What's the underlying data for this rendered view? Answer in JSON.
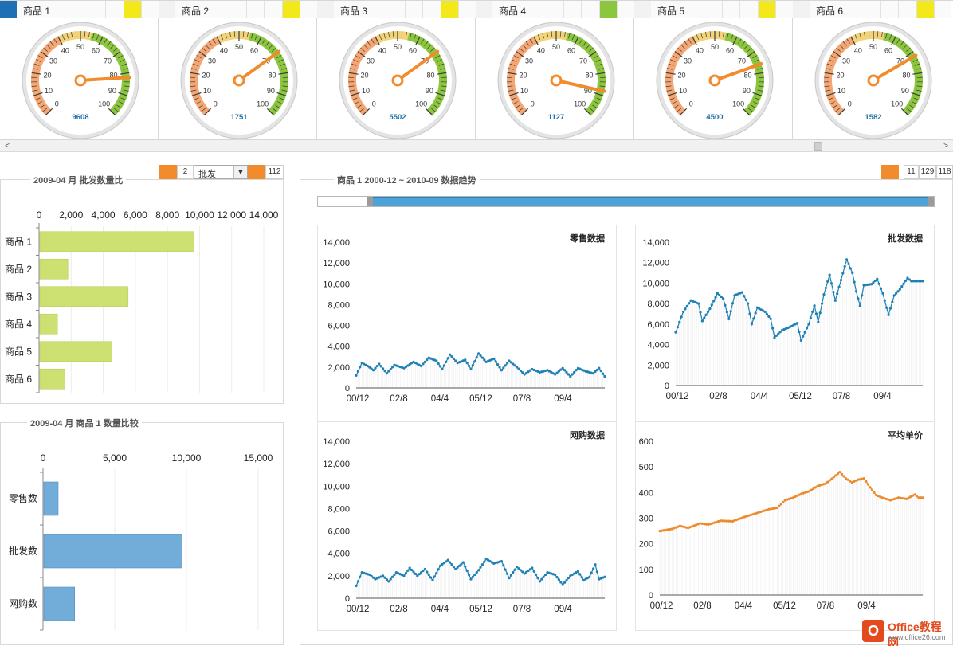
{
  "colors": {
    "accent_orange": "#f28b2b",
    "selected_blue": "#1f6fb5",
    "flag_yellow": "#f3e81a",
    "flag_green": "#8cc63f",
    "bar_lime": "#cde172",
    "bar_blue": "#72acd8",
    "line_blue": "#1f80b4",
    "line_orange": "#ee8a2c"
  },
  "gauges": [
    {
      "name": "商品 1",
      "value": 9608,
      "needle": 82,
      "flag": "yellow",
      "selected": true
    },
    {
      "name": "商品 2",
      "value": 1751,
      "needle": 70,
      "flag": "yellow",
      "selected": false
    },
    {
      "name": "商品 3",
      "value": 5502,
      "needle": 70,
      "flag": "yellow",
      "selected": false
    },
    {
      "name": "商品 4",
      "value": 1127,
      "needle": 88,
      "flag": "green",
      "selected": false
    },
    {
      "name": "商品 5",
      "value": 4500,
      "needle": 76,
      "flag": "yellow",
      "selected": false
    },
    {
      "name": "商品 6",
      "value": 1582,
      "needle": 72,
      "flag": "yellow",
      "selected": false
    }
  ],
  "gauge_ticks": [
    "0",
    "10",
    "20",
    "30",
    "40",
    "50",
    "60",
    "70",
    "80",
    "90",
    "100"
  ],
  "scroll": {
    "left_arrow": "<",
    "right_arrow": ">"
  },
  "wholesale_panel": {
    "title": "2009-04 月 批发数量比",
    "counter": "2",
    "dropdown_value": "批发",
    "dropdown_arrow": "▼",
    "right_value": "112"
  },
  "compare_panel": {
    "title": "2009-04 月  商品 1 数量比较"
  },
  "trend_panel": {
    "title": "商品 1   2000-12 ~ 2010-09  数据趋势",
    "boxes": [
      "11",
      "129",
      "118"
    ]
  },
  "chart_data": [
    {
      "id": "wholesale_ratio",
      "type": "bar",
      "orientation": "horizontal",
      "title": "2009-04 月 批发数量比",
      "categories": [
        "商品 1",
        "商品 2",
        "商品 3",
        "商品 4",
        "商品 5",
        "商品 6"
      ],
      "values": [
        9600,
        1750,
        5500,
        1100,
        4500,
        1550
      ],
      "xlim": [
        0,
        14000
      ],
      "ticks": [
        "0",
        "2,000",
        "4,000",
        "6,000",
        "8,000",
        "10,000",
        "12,000",
        "14,000"
      ],
      "axis_position": "top",
      "grid": true
    },
    {
      "id": "quantity_compare",
      "type": "bar",
      "orientation": "horizontal",
      "title": "2009-04 月  商品 1 数量比较",
      "categories": [
        "零售数",
        "批发数",
        "网购数"
      ],
      "values": [
        1000,
        9650,
        2150
      ],
      "xlim": [
        0,
        15000
      ],
      "ticks": [
        "0",
        "5,000",
        "10,000",
        "15,000"
      ],
      "axis_position": "top",
      "grid": true
    },
    {
      "id": "retail",
      "type": "line",
      "title": "零售数据",
      "ylim": [
        0,
        14000
      ],
      "yticks": [
        "14,000",
        "12,000",
        "10,000",
        "8,000",
        "6,000",
        "4,000",
        "2,000",
        "0"
      ],
      "xticks": [
        "00/12",
        "02/8",
        "04/4",
        "05/12",
        "07/8",
        "09/4"
      ],
      "keypoints": [
        [
          0,
          1200
        ],
        [
          3,
          2400
        ],
        [
          6,
          2100
        ],
        [
          9,
          1700
        ],
        [
          12,
          2300
        ],
        [
          16,
          1400
        ],
        [
          20,
          2200
        ],
        [
          25,
          1900
        ],
        [
          30,
          2500
        ],
        [
          34,
          2100
        ],
        [
          38,
          2900
        ],
        [
          42,
          2600
        ],
        [
          45,
          1800
        ],
        [
          49,
          3200
        ],
        [
          53,
          2400
        ],
        [
          57,
          2700
        ],
        [
          60,
          1800
        ],
        [
          64,
          3300
        ],
        [
          68,
          2500
        ],
        [
          72,
          2800
        ],
        [
          76,
          1700
        ],
        [
          80,
          2600
        ],
        [
          84,
          2000
        ],
        [
          88,
          1300
        ],
        [
          92,
          1800
        ],
        [
          96,
          1500
        ],
        [
          100,
          1700
        ],
        [
          104,
          1300
        ],
        [
          108,
          1900
        ],
        [
          112,
          1100
        ],
        [
          116,
          1900
        ],
        [
          120,
          1600
        ],
        [
          124,
          1400
        ],
        [
          127,
          1900
        ],
        [
          130,
          1100
        ]
      ]
    },
    {
      "id": "wholesale",
      "type": "line",
      "title": "批发数据",
      "ylim": [
        0,
        14000
      ],
      "yticks": [
        "14,000",
        "12,000",
        "10,000",
        "8,000",
        "6,000",
        "4,000",
        "2,000",
        "0"
      ],
      "xticks": [
        "00/12",
        "02/8",
        "04/4",
        "05/12",
        "07/8",
        "09/4"
      ],
      "keypoints": [
        [
          0,
          5200
        ],
        [
          4,
          7200
        ],
        [
          8,
          8300
        ],
        [
          12,
          8000
        ],
        [
          14,
          6300
        ],
        [
          18,
          7500
        ],
        [
          22,
          9000
        ],
        [
          25,
          8500
        ],
        [
          28,
          6500
        ],
        [
          31,
          8800
        ],
        [
          35,
          9100
        ],
        [
          38,
          8000
        ],
        [
          40,
          6000
        ],
        [
          43,
          7600
        ],
        [
          47,
          7200
        ],
        [
          50,
          6500
        ],
        [
          52,
          4700
        ],
        [
          56,
          5400
        ],
        [
          60,
          5700
        ],
        [
          64,
          6100
        ],
        [
          66,
          4400
        ],
        [
          70,
          6000
        ],
        [
          73,
          7800
        ],
        [
          75,
          6200
        ],
        [
          78,
          8900
        ],
        [
          81,
          10800
        ],
        [
          84,
          8300
        ],
        [
          87,
          10300
        ],
        [
          90,
          12300
        ],
        [
          93,
          11000
        ],
        [
          95,
          9200
        ],
        [
          97,
          7800
        ],
        [
          99,
          9800
        ],
        [
          103,
          9900
        ],
        [
          106,
          10400
        ],
        [
          109,
          9000
        ],
        [
          112,
          6900
        ],
        [
          115,
          8800
        ],
        [
          118,
          9400
        ],
        [
          122,
          10500
        ],
        [
          124,
          10200
        ]
      ]
    },
    {
      "id": "online",
      "type": "line",
      "title": "网购数据",
      "ylim": [
        0,
        14000
      ],
      "yticks": [
        "14,000",
        "12,000",
        "10,000",
        "8,000",
        "6,000",
        "4,000",
        "2,000",
        "0"
      ],
      "xticks": [
        "00/12",
        "02/8",
        "04/4",
        "05/12",
        "07/8",
        "09/4"
      ],
      "keypoints": [
        [
          0,
          1100
        ],
        [
          3,
          2300
        ],
        [
          7,
          2100
        ],
        [
          10,
          1700
        ],
        [
          14,
          2000
        ],
        [
          17,
          1500
        ],
        [
          21,
          2300
        ],
        [
          25,
          2000
        ],
        [
          28,
          2700
        ],
        [
          32,
          2000
        ],
        [
          36,
          2600
        ],
        [
          40,
          1600
        ],
        [
          44,
          2900
        ],
        [
          48,
          3400
        ],
        [
          52,
          2600
        ],
        [
          56,
          3200
        ],
        [
          60,
          1700
        ],
        [
          64,
          2500
        ],
        [
          68,
          3500
        ],
        [
          72,
          3100
        ],
        [
          76,
          3300
        ],
        [
          80,
          1800
        ],
        [
          84,
          2800
        ],
        [
          88,
          2200
        ],
        [
          92,
          2700
        ],
        [
          96,
          1500
        ],
        [
          100,
          2300
        ],
        [
          104,
          2100
        ],
        [
          108,
          1200
        ],
        [
          112,
          2000
        ],
        [
          116,
          2400
        ],
        [
          119,
          1600
        ],
        [
          122,
          1900
        ],
        [
          125,
          3000
        ],
        [
          127,
          1700
        ],
        [
          130,
          1900
        ]
      ]
    },
    {
      "id": "avg_price",
      "type": "line",
      "title": "平均单价",
      "ylim": [
        0,
        600
      ],
      "yticks": [
        "600",
        "500",
        "400",
        "300",
        "200",
        "100",
        "0"
      ],
      "xticks": [
        "00/12",
        "02/8",
        "04/4",
        "05/12",
        "07/8",
        "09/4"
      ],
      "keypoints": [
        [
          0,
          250
        ],
        [
          6,
          258
        ],
        [
          10,
          270
        ],
        [
          14,
          262
        ],
        [
          20,
          280
        ],
        [
          24,
          275
        ],
        [
          30,
          290
        ],
        [
          36,
          288
        ],
        [
          42,
          305
        ],
        [
          48,
          320
        ],
        [
          54,
          335
        ],
        [
          58,
          340
        ],
        [
          62,
          370
        ],
        [
          66,
          380
        ],
        [
          70,
          395
        ],
        [
          74,
          405
        ],
        [
          78,
          425
        ],
        [
          82,
          435
        ],
        [
          86,
          460
        ],
        [
          89,
          480
        ],
        [
          92,
          455
        ],
        [
          95,
          440
        ],
        [
          98,
          450
        ],
        [
          101,
          455
        ],
        [
          104,
          420
        ],
        [
          107,
          390
        ],
        [
          110,
          380
        ],
        [
          114,
          370
        ],
        [
          118,
          380
        ],
        [
          122,
          375
        ],
        [
          126,
          392
        ],
        [
          128,
          380
        ],
        [
          130,
          380
        ]
      ]
    }
  ],
  "watermark": {
    "logo": "O",
    "line1": "Office教程网",
    "line2": "www.office26.com"
  }
}
